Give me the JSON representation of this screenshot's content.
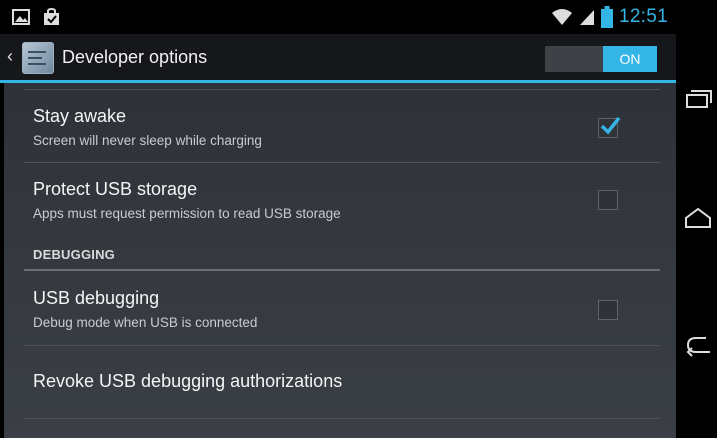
{
  "status_bar": {
    "time": "12:51",
    "left_icons": [
      "image-icon",
      "shopping-bag-icon"
    ],
    "right_icons": [
      "wifi-icon",
      "signal-icon",
      "battery-icon"
    ]
  },
  "action_bar": {
    "title": "Developer options",
    "toggle_label": "ON",
    "toggle_state": "on"
  },
  "settings": {
    "stay_awake": {
      "title": "Stay awake",
      "summary": "Screen will never sleep while charging",
      "checked": true
    },
    "protect_usb": {
      "title": "Protect USB storage",
      "summary": "Apps must request permission to read USB storage",
      "checked": false
    },
    "debugging_header": "DEBUGGING",
    "usb_debugging": {
      "title": "USB debugging",
      "summary": "Debug mode when USB is connected",
      "checked": false
    },
    "revoke": {
      "title": "Revoke USB debugging authorizations"
    }
  },
  "navigation": [
    "recent-apps-icon",
    "home-icon",
    "back-icon"
  ],
  "colors": {
    "accent": "#33b5e5",
    "background": "#33373d",
    "action_bar": "#15171a"
  }
}
